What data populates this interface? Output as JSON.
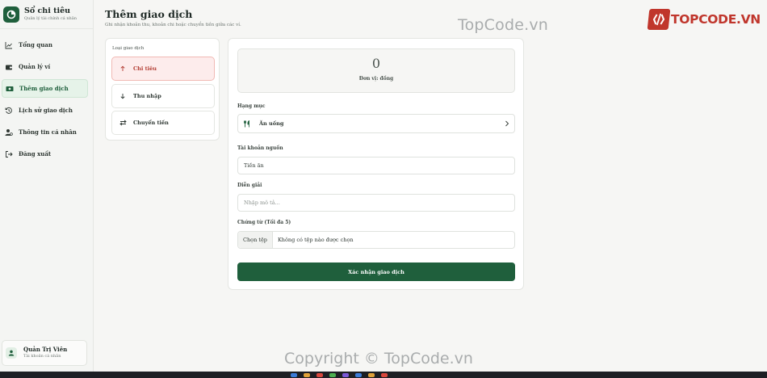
{
  "app": {
    "title": "Sổ chi tiêu",
    "subtitle": "Quản lý tài chính cá nhân",
    "brand_color": "#1f5f3c"
  },
  "sidebar": {
    "items": [
      {
        "label": "Tổng quan",
        "icon": "chart-line-icon",
        "active": false
      },
      {
        "label": "Quản lý ví",
        "icon": "wallet-icon",
        "active": false
      },
      {
        "label": "Thêm giao dịch",
        "icon": "money-icon",
        "active": true
      },
      {
        "label": "Lịch sử giao dịch",
        "icon": "history-icon",
        "active": false
      },
      {
        "label": "Thông tin cá nhân",
        "icon": "user-cog-icon",
        "active": false
      },
      {
        "label": "Đăng xuất",
        "icon": "logout-icon",
        "active": false
      }
    ],
    "user": {
      "name": "Quản Trị Viên",
      "role": "Tài khoản cá nhân"
    }
  },
  "header": {
    "title": "Thêm giao dịch",
    "subtitle": "Ghi nhận khoản thu, khoản chi hoặc chuyển tiền giữa các ví."
  },
  "type_card": {
    "label": "Loại giao dịch",
    "options": [
      {
        "label": "Chi tiêu",
        "icon": "arrow-up-icon",
        "active": true
      },
      {
        "label": "Thu nhập",
        "icon": "arrow-down-icon",
        "active": false
      },
      {
        "label": "Chuyển tiền",
        "icon": "transfer-icon",
        "active": false
      }
    ]
  },
  "form": {
    "amount": "0",
    "unit": "Đơn vị: đồng",
    "category_label": "Hạng mục",
    "category_value": "Ăn uống",
    "account_label": "Tài khoản nguồn",
    "account_value": "Tiền ăn",
    "description_label": "Diễn giải",
    "description_placeholder": "Nhập mô tả...",
    "attachments_label": "Chứng từ (Tối đa 5)",
    "file_button": "Chọn tệp",
    "file_status": "Không có tệp nào được chọn",
    "submit_label": "Xác nhận giao dịch"
  },
  "watermarks": {
    "top": "TopCode.vn",
    "logo_text": "TOPCODE.VN",
    "bottom": "Copyright © TopCode.vn"
  },
  "colors": {
    "expense_accent": "#b23b31",
    "expense_bg": "#fdecec",
    "active_nav_bg": "#e6f3e9"
  }
}
